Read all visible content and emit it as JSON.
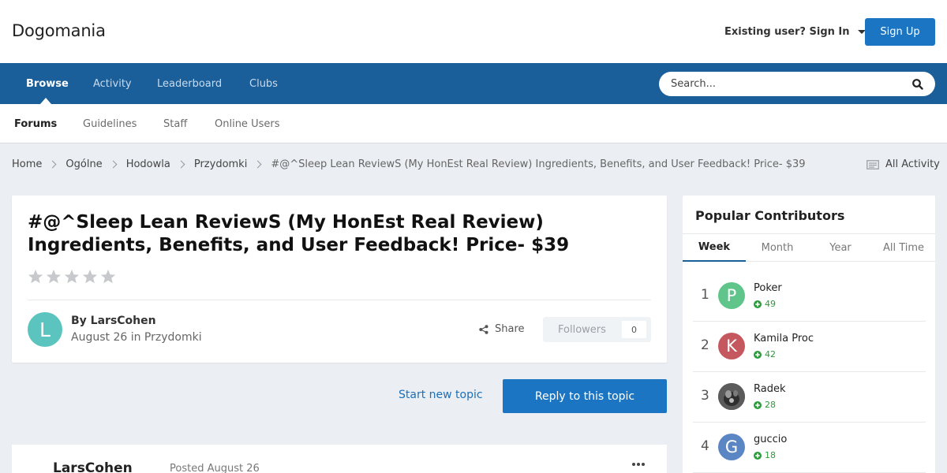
{
  "site": {
    "title": "Dogomania"
  },
  "header": {
    "signin_label": "Existing user? Sign In",
    "signup_label": "Sign Up"
  },
  "nav": {
    "items": [
      {
        "label": "Browse",
        "active": true
      },
      {
        "label": "Activity"
      },
      {
        "label": "Leaderboard"
      },
      {
        "label": "Clubs"
      }
    ],
    "search_placeholder": "Search..."
  },
  "subnav": {
    "items": [
      {
        "label": "Forums",
        "active": true
      },
      {
        "label": "Guidelines"
      },
      {
        "label": "Staff"
      },
      {
        "label": "Online Users"
      }
    ]
  },
  "breadcrumb": {
    "items": [
      "Home",
      "Ogólne",
      "Hodowla",
      "Przydomki"
    ],
    "current": "#@^Sleep Lean ReviewS (My HonEst Real Review) Ingredients, Benefits, and User Feedback! Price- $39",
    "all_activity": "All Activity"
  },
  "topic": {
    "title": "#@^Sleep Lean ReviewS (My HonEst Real Review) Ingredients, Benefits, and User Feedback! Price- $39",
    "rating": 0,
    "author_initial": "L",
    "by_author": "By LarsCohen",
    "posted_meta": "August 26 in Przydomki",
    "share_label": "Share",
    "followers_label": "Followers",
    "followers_count": "0"
  },
  "actions": {
    "start_topic": "Start new topic",
    "reply": "Reply to this topic"
  },
  "post": {
    "author": "LarsCohen",
    "posted": "Posted August 26"
  },
  "sidebar": {
    "title": "Popular Contributors",
    "tabs": [
      {
        "label": "Week",
        "active": true
      },
      {
        "label": "Month"
      },
      {
        "label": "Year"
      },
      {
        "label": "All Time"
      }
    ],
    "contributors": [
      {
        "rank": "1",
        "initial": "P",
        "name": "Poker",
        "rep": "49",
        "color": "#5fc58a"
      },
      {
        "rank": "2",
        "initial": "K",
        "name": "Kamila Proc",
        "rep": "42",
        "color": "#c4585e"
      },
      {
        "rank": "3",
        "initial": "",
        "name": "Radek",
        "rep": "28",
        "color": "#555555"
      },
      {
        "rank": "4",
        "initial": "G",
        "name": "guccio",
        "rep": "18",
        "color": "#5b86c4"
      }
    ]
  },
  "colors": {
    "brand": "#1a5e9a",
    "button": "#1c75c3",
    "reputation": "#2c9b3a"
  }
}
